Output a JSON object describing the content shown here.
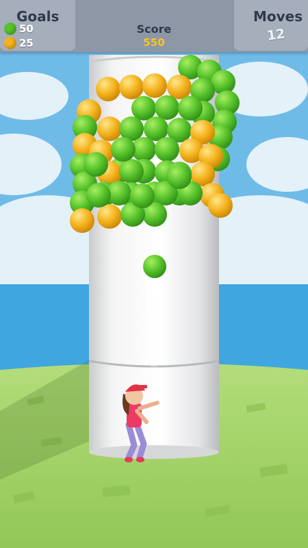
{
  "hud": {
    "goals_label": "Goals",
    "goals": [
      {
        "color": "#57c22b",
        "count": "50",
        "icon": "green-ball-icon"
      },
      {
        "color": "#f4b21c",
        "count": "25",
        "icon": "yellow-ball-icon"
      }
    ],
    "score_label": "Score",
    "score_value": "550",
    "moves_label": "Moves",
    "moves_value": "12"
  },
  "colors": {
    "sky": "#6fbbe8",
    "sea": "#3fa6e0",
    "grass": "#9fd064",
    "tower": "#f1f1f1",
    "green_ball": "#57c22b",
    "yellow_ball": "#f4b21c",
    "hud_bar": "#8e97a6",
    "hud_panel": "#a6aebb",
    "score_text": "#f6c426"
  },
  "balls": [
    "G",
    "G",
    "G",
    "G",
    "G",
    "Y",
    "Y",
    "Y",
    "Y",
    "G",
    "G",
    "G",
    "G",
    "G",
    "Y",
    "G",
    "G",
    "G",
    "Y",
    "G",
    "G",
    "G",
    "Y",
    "Y",
    "Y",
    "G",
    "G",
    "Y",
    "Y",
    "G",
    "G",
    "Y",
    "Y",
    "G",
    "G",
    "G",
    "G",
    "Y",
    "Y",
    "G",
    "G",
    "G",
    "G",
    "G",
    "G",
    "G",
    "G",
    "G",
    "G",
    "Y",
    "Y",
    "G",
    "G",
    "G",
    "G",
    "G",
    "G"
  ],
  "shot_ball": "G"
}
